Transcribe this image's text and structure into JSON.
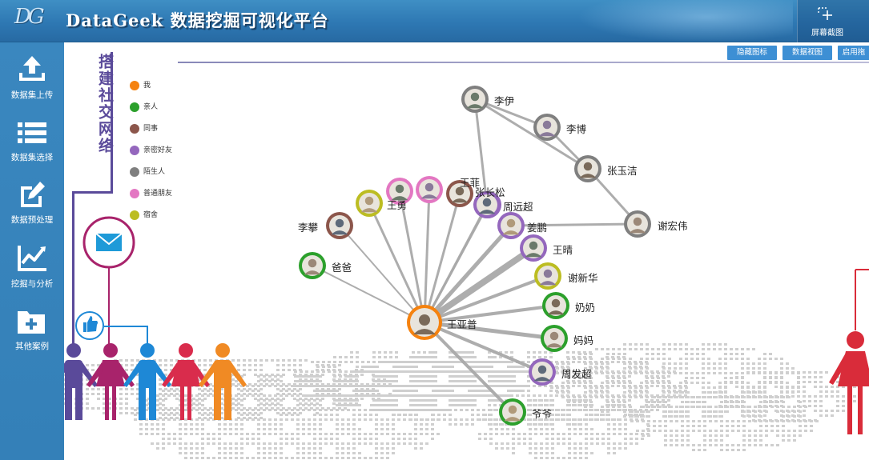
{
  "header": {
    "logo_text": "DG",
    "title": "DataGeek 数据挖掘可视化平台",
    "screenshot_label": "屏幕截图"
  },
  "sidebar": {
    "items": [
      {
        "label": "数据集上传",
        "icon": "upload-icon"
      },
      {
        "label": "数据集选择",
        "icon": "list-icon"
      },
      {
        "label": "数据预处理",
        "icon": "edit-icon"
      },
      {
        "label": "挖掘与分析",
        "icon": "line-chart-icon"
      },
      {
        "label": "其他案例",
        "icon": "folder-add-icon"
      }
    ]
  },
  "toolbar": {
    "buttons": [
      "隐藏图标",
      "数据视图",
      "启用拖"
    ]
  },
  "main": {
    "vertical_title": "搭建社交网络"
  },
  "legend": [
    {
      "label": "我",
      "color": "#f5820f"
    },
    {
      "label": "亲人",
      "color": "#2ca02c"
    },
    {
      "label": "同事",
      "color": "#8c564b"
    },
    {
      "label": "亲密好友",
      "color": "#9467bd"
    },
    {
      "label": "陌生人",
      "color": "#7f7f7f"
    },
    {
      "label": "普通朋友",
      "color": "#e377c2"
    },
    {
      "label": "宿舍",
      "color": "#bcbd22"
    }
  ],
  "graph": {
    "nodes": [
      {
        "id": "wangyapu",
        "label": "王亚普",
        "group": "我"
      },
      {
        "id": "baba",
        "label": "爸爸",
        "group": "亲人"
      },
      {
        "id": "lipan",
        "label": "李攀",
        "group": "同事"
      },
      {
        "id": "wangyong",
        "label": "王勇",
        "group": "宿舍"
      },
      {
        "id": "p_pink",
        "label": "",
        "group": "普通朋友"
      },
      {
        "id": "p_pink2",
        "label": "",
        "group": "普通朋友"
      },
      {
        "id": "wangdi",
        "label": "王菲",
        "group": "同事"
      },
      {
        "id": "zhangsong",
        "label": "张长松",
        "group": "亲密好友"
      },
      {
        "id": "zhouyuanchao",
        "label": "周远超",
        "group": "亲密好友"
      },
      {
        "id": "jiangpeng",
        "label": "姜鹏",
        "group": "亲密好友"
      },
      {
        "id": "wangqing",
        "label": "王晴",
        "group": "亲密好友"
      },
      {
        "id": "xiexinhua",
        "label": "谢新华",
        "group": "宿舍"
      },
      {
        "id": "nainai",
        "label": "奶奶",
        "group": "亲人"
      },
      {
        "id": "mama",
        "label": "妈妈",
        "group": "亲人"
      },
      {
        "id": "zhoufachao",
        "label": "周发超",
        "group": "亲密好友"
      },
      {
        "id": "yeye",
        "label": "爷爷",
        "group": "亲人"
      },
      {
        "id": "liyi",
        "label": "李伊",
        "group": "陌生人"
      },
      {
        "id": "libo",
        "label": "李博",
        "group": "陌生人"
      },
      {
        "id": "zhangyujie",
        "label": "张玉洁",
        "group": "陌生人"
      },
      {
        "id": "xiehongwei",
        "label": "谢宏伟",
        "group": "陌生人"
      }
    ],
    "links": [
      {
        "source": "wangyapu",
        "target": "baba",
        "weight": 2
      },
      {
        "source": "wangyapu",
        "target": "lipan",
        "weight": 2
      },
      {
        "source": "wangyapu",
        "target": "wangyong",
        "weight": 3
      },
      {
        "source": "wangyapu",
        "target": "p_pink",
        "weight": 3
      },
      {
        "source": "wangyapu",
        "target": "p_pink2",
        "weight": 3
      },
      {
        "source": "wangyapu",
        "target": "wangdi",
        "weight": 3
      },
      {
        "source": "wangyapu",
        "target": "zhangsong",
        "weight": 3
      },
      {
        "source": "wangyapu",
        "target": "zhouyuanchao",
        "weight": 3
      },
      {
        "source": "wangyapu",
        "target": "jiangpeng",
        "weight": 5
      },
      {
        "source": "wangyapu",
        "target": "wangqing",
        "weight": 8
      },
      {
        "source": "wangyapu",
        "target": "xiexinhua",
        "weight": 4
      },
      {
        "source": "wangyapu",
        "target": "nainai",
        "weight": 4
      },
      {
        "source": "wangyapu",
        "target": "mama",
        "weight": 5
      },
      {
        "source": "wangyapu",
        "target": "zhoufachao",
        "weight": 4
      },
      {
        "source": "wangyapu",
        "target": "yeye",
        "weight": 4
      },
      {
        "source": "liyi",
        "target": "libo",
        "weight": 3
      },
      {
        "source": "liyi",
        "target": "zhangyujie",
        "weight": 3
      },
      {
        "source": "liyi",
        "target": "zhouyuanchao",
        "weight": 3
      },
      {
        "source": "libo",
        "target": "zhangyujie",
        "weight": 3
      },
      {
        "source": "zhangyujie",
        "target": "xiehongwei",
        "weight": 3
      },
      {
        "source": "jiangpeng",
        "target": "xiehongwei",
        "weight": 3
      }
    ]
  }
}
